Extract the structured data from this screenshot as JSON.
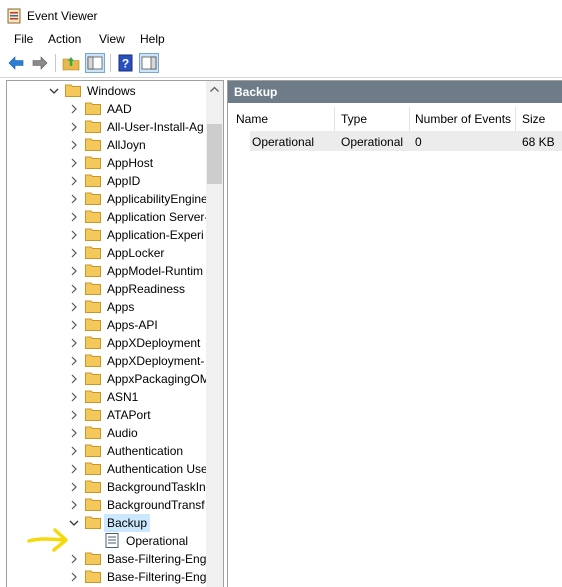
{
  "window": {
    "title": "Event Viewer"
  },
  "menu": [
    "File",
    "Action",
    "View",
    "Help"
  ],
  "toolbar": {
    "buttons": [
      "back-arrow-icon",
      "forward-arrow-icon",
      "up-folder-icon",
      "show-hide-tree-icon",
      "help-icon",
      "show-action-pane-icon"
    ]
  },
  "tree": {
    "parent": "Windows",
    "items": [
      "AAD",
      "All-User-Install-Ag",
      "AllJoyn",
      "AppHost",
      "AppID",
      "ApplicabilityEngine",
      "Application Server-",
      "Application-Experi",
      "AppLocker",
      "AppModel-Runtim",
      "AppReadiness",
      "Apps",
      "Apps-API",
      "AppXDeployment",
      "AppXDeployment-",
      "AppxPackagingOM",
      "ASN1",
      "ATAPort",
      "Audio",
      "Authentication",
      "Authentication Use",
      "BackgroundTaskIn",
      "BackgroundTransf",
      "Backup"
    ],
    "selected": "Backup",
    "child": "Operational",
    "after": [
      "Base-Filtering-Eng",
      "Base-Filtering-Eng"
    ]
  },
  "panel": {
    "title": "Backup",
    "columns": [
      "Name",
      "Type",
      "Number of Events",
      "Size"
    ],
    "rows": [
      {
        "name": "Operational",
        "type": "Operational",
        "events": "0",
        "size": "68 KB"
      }
    ]
  },
  "colors": {
    "header_bg": "#6e7c89",
    "selection": "#cce8ff",
    "folder": "#e8b84a",
    "annotation": "#f5d90a"
  }
}
